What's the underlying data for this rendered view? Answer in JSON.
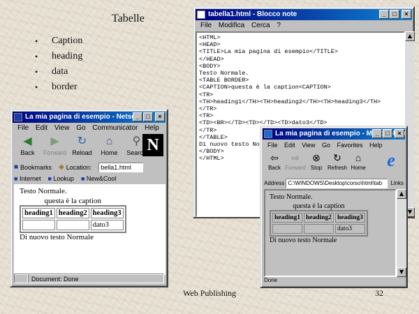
{
  "slide": {
    "title": "Tabelle",
    "bullets": [
      "Caption",
      "heading",
      "data",
      "border"
    ],
    "footer": "Web Publishing",
    "page_number": "32"
  },
  "notepad": {
    "title": "tabella1.html - Blocco note",
    "menu": [
      "File",
      "Modifica",
      "Cerca",
      "?"
    ],
    "content": "<HTML>\n<HEAD>\n<TITLE>La mia pagina di esempio</TITLE>\n</HEAD>\n<BODY>\nTesto Normale.\n<TABLE BORDER>\n<CAPTION>questa è la caption<CAPTION>\n<TR>\n<TH>heading1</TH><TH>heading2</TH><TH>heading3</TH>\n</TR>\n<TR>\n<TD><BR></TD><TD></TD><TD>dato3</TD>\n</TR>\n</TABLE>\nDi nuovo testo Normale\n</BODY>\n</HTML>"
  },
  "netscape": {
    "title": "La mia pagina di esempio - Netsc",
    "menu": [
      "File",
      "Edit",
      "View",
      "Go",
      "Communicator",
      "Help"
    ],
    "toolbar": {
      "back": "Back",
      "forward": "Forward",
      "reload": "Reload",
      "home": "Home",
      "search": "Search"
    },
    "logo": "N",
    "bookmarks_label": "Bookmarks",
    "location_label": "Location:",
    "location_value": "bella1.html",
    "linkbar": {
      "internet": "Internet",
      "lookup": "Lookup",
      "newcool": "New&Cool"
    },
    "page": {
      "text1": "Testo Normale.",
      "caption": "questa è la caption",
      "headings": [
        "heading1",
        "heading2",
        "heading3"
      ],
      "data": [
        "",
        "",
        "dato3"
      ],
      "text2": "Di nuovo testo Normale"
    },
    "status": "Document: Done"
  },
  "ie": {
    "title": "La mia pagina di esempio - Microsoft In",
    "menu": [
      "File",
      "Edit",
      "View",
      "Go",
      "Favorites",
      "Help"
    ],
    "toolbar": {
      "back": "Back",
      "forward": "Forward",
      "stop": "Stop",
      "refresh": "Refresh",
      "home": "Home"
    },
    "logo": "e",
    "address_label": "Address",
    "address_value": "C:\\WINDOWS\\Desktop\\corso\\html\\tab",
    "links_label": "Links",
    "page": {
      "text1": "Testo Normale.",
      "caption": "questa è la caption",
      "headings": [
        "heading1",
        "heading2",
        "heading3"
      ],
      "data": [
        "",
        "",
        "dato3"
      ],
      "text2": "Di nuovo testo Normale"
    },
    "status": "Done"
  },
  "colors": {
    "titlebar": "#000080",
    "window_face": "#c0c0c0",
    "slide_background": "#e6dfd2",
    "ie_logo": "#1c6ad8"
  }
}
